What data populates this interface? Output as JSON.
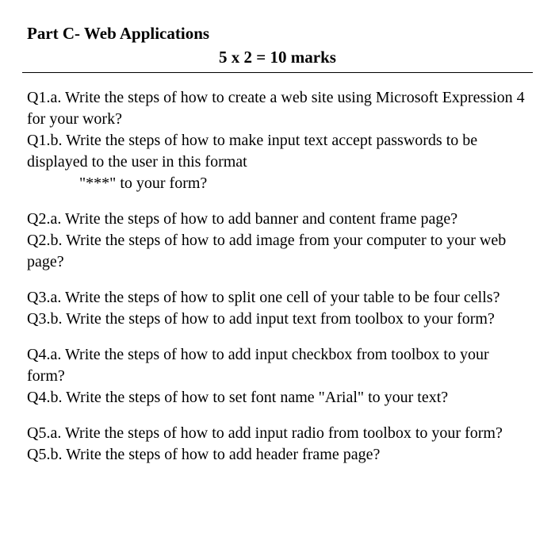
{
  "header": {
    "title": "Part C- Web Applications",
    "marks": "5 x 2 = 10 marks"
  },
  "q1": {
    "a": "Q1.a. Write the steps of how to create a web site using Microsoft Expression 4 for your work?",
    "b": "Q1.b. Write the steps of how to make input text accept passwords to be displayed to the user in this format",
    "b_extra": "\"***\" to your form?"
  },
  "q2": {
    "a": "Q2.a. Write the steps of how to add banner and content frame page?",
    "b": "Q2.b. Write the steps of how to add image from your computer to your web page?"
  },
  "q3": {
    "a": "Q3.a. Write the steps of how to split one cell of your table to be four cells?",
    "b": "Q3.b. Write the steps of how to add input text from toolbox to your form?"
  },
  "q4": {
    "a": "Q4.a. Write the steps of how to add input checkbox from toolbox to your form?",
    "b": "Q4.b. Write the steps of how to set font name \"Arial\" to your text?"
  },
  "q5": {
    "a": "Q5.a. Write the steps of how to add input radio from toolbox to your form?",
    "b": "Q5.b. Write the steps of how to add header frame page?"
  }
}
